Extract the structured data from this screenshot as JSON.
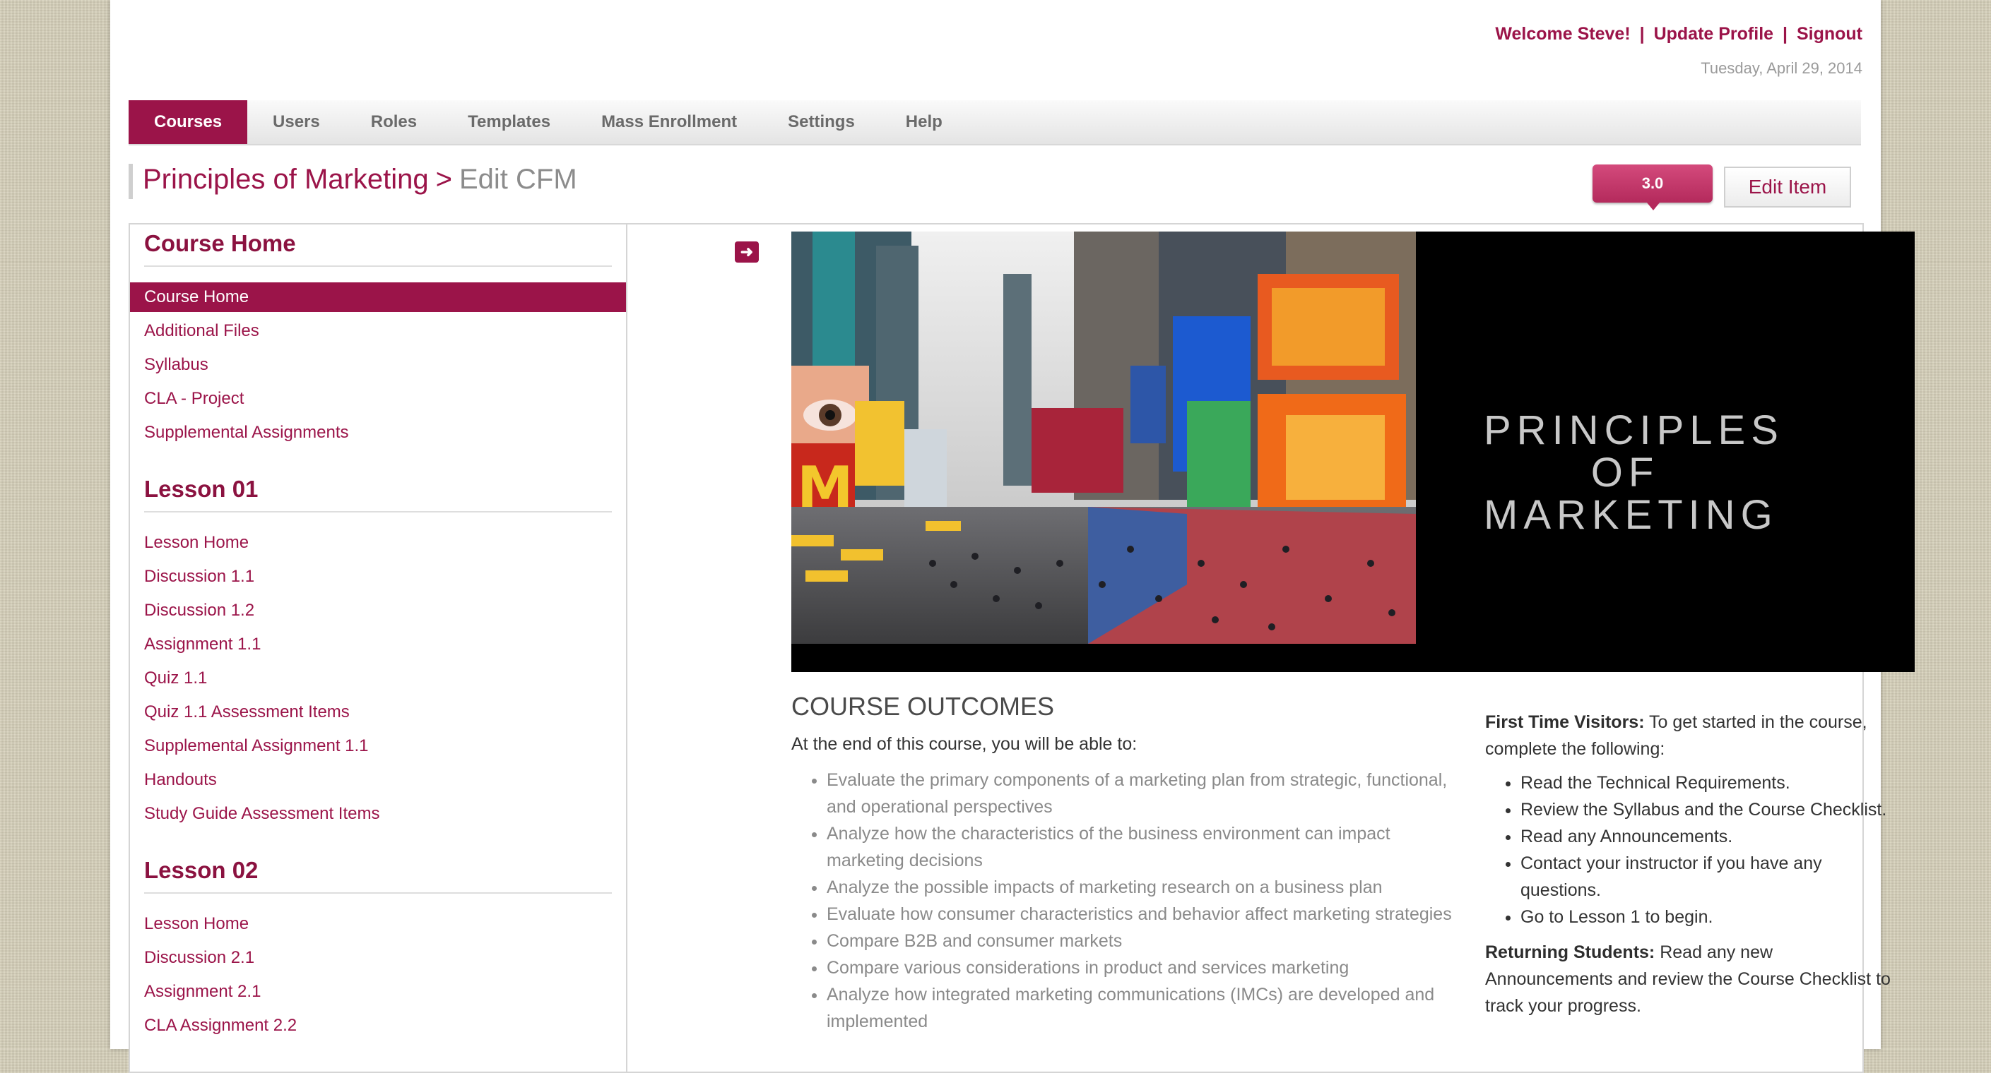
{
  "header": {
    "welcome": "Welcome Steve!",
    "update_profile": "Update Profile",
    "signout": "Signout",
    "separator": "|",
    "date": "Tuesday, April 29, 2014"
  },
  "nav": {
    "tabs": [
      {
        "label": "Courses",
        "active": true
      },
      {
        "label": "Users"
      },
      {
        "label": "Roles"
      },
      {
        "label": "Templates"
      },
      {
        "label": "Mass Enrollment"
      },
      {
        "label": "Settings"
      },
      {
        "label": "Help"
      }
    ]
  },
  "title": {
    "course": "Principles of Marketing",
    "arrow": ">",
    "page": "Edit CFM"
  },
  "toolbar": {
    "version": "3.0",
    "edit_item": "Edit Item"
  },
  "sidebar": {
    "sections": [
      {
        "title": "Course Home",
        "items": [
          "Course Home",
          "Additional Files",
          "Syllabus",
          "CLA - Project",
          "Supplemental Assignments"
        ]
      },
      {
        "title": "Lesson 01",
        "items": [
          "Lesson Home",
          "Discussion 1.1",
          "Discussion 1.2",
          "Assignment 1.1",
          "Quiz 1.1",
          "Quiz 1.1 Assessment Items",
          "Supplemental Assignment 1.1",
          "Handouts",
          "Study Guide Assessment Items"
        ]
      },
      {
        "title": "Lesson 02",
        "items": [
          "Lesson Home",
          "Discussion 2.1",
          "Assignment 2.1",
          "CLA Assignment 2.2"
        ]
      }
    ]
  },
  "banner": {
    "title_line1": "PRINCIPLES OF",
    "title_line2": "MARKETING"
  },
  "outcomes": {
    "title": "COURSE OUTCOMES",
    "intro": "At the end of this course, you will be able to:",
    "items": [
      "Evaluate the primary components of a marketing plan from strategic, functional, and operational perspectives",
      "Analyze how the characteristics of the business environment can impact marketing decisions",
      "Analyze the possible impacts of marketing research on a business plan",
      "Evaluate how consumer characteristics and behavior affect marketing strategies",
      "Compare B2B and consumer markets",
      "Compare various considerations in product and services marketing",
      "Analyze how integrated marketing communications (IMCs) are developed and implemented"
    ]
  },
  "visitors": {
    "first_label": "First Time Visitors:",
    "first_text": " To get started in the course, complete the following:",
    "steps": [
      "Read the Technical Requirements.",
      "Review the Syllabus and the Course Checklist.",
      "Read any Announcements.",
      "Contact your instructor if you have any questions.",
      "Go to Lesson 1 to begin."
    ],
    "returning_label": "Returning Students:",
    "returning_text": " Read any new Announcements and review the Course Checklist to track your progress."
  }
}
